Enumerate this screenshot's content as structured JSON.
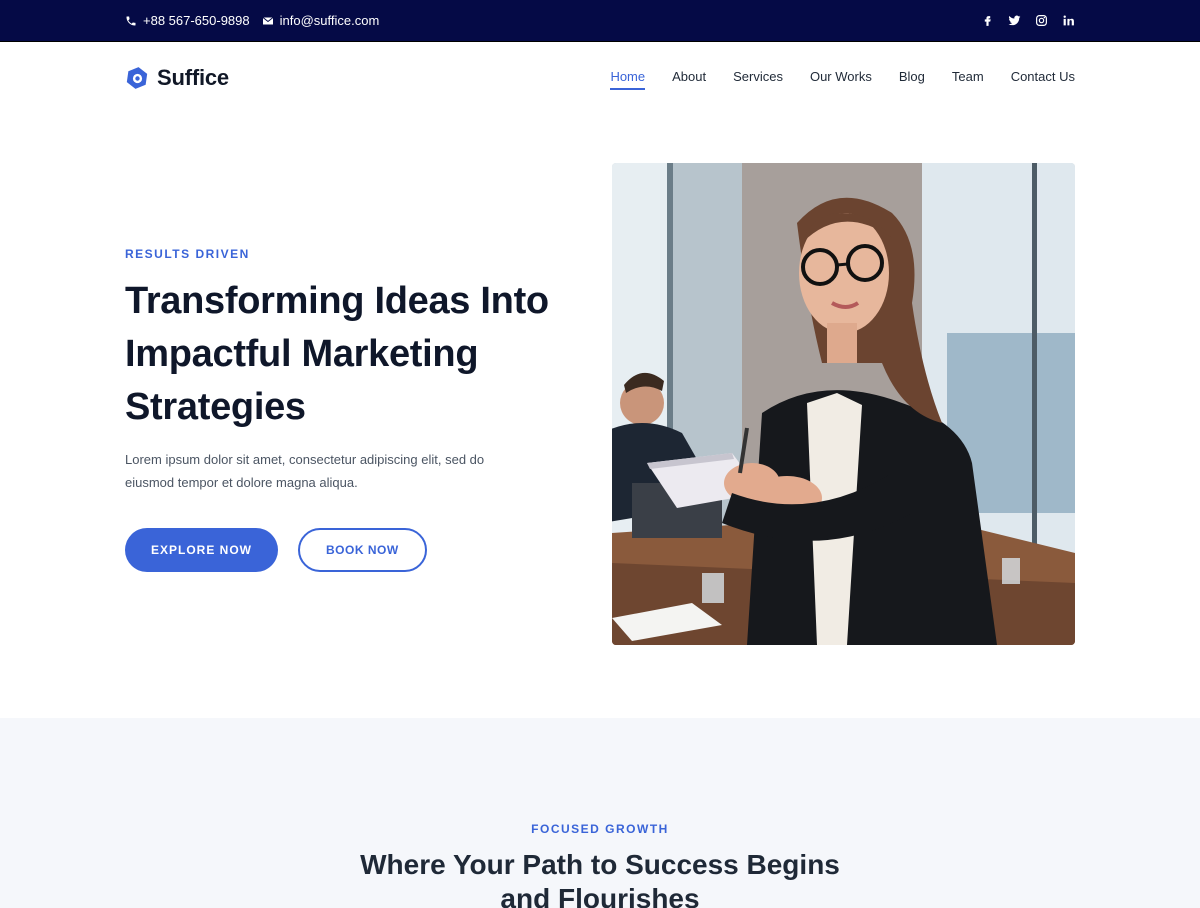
{
  "topbar": {
    "phone": "+88 567-650-9898",
    "email": "info@suffice.com",
    "socials": [
      "facebook",
      "twitter",
      "instagram",
      "linkedin"
    ]
  },
  "header": {
    "logo_text": "Suffice",
    "nav": [
      {
        "label": "Home",
        "active": true
      },
      {
        "label": "About"
      },
      {
        "label": "Services"
      },
      {
        "label": "Our Works"
      },
      {
        "label": "Blog"
      },
      {
        "label": "Team"
      },
      {
        "label": "Contact Us"
      }
    ]
  },
  "hero": {
    "eyebrow": "RESULTS DRIVEN",
    "title": "Transforming Ideas Into Impactful Marketing Strategies",
    "description": "Lorem ipsum dolor sit amet, consectetur adipiscing elit, sed do eiusmod tempor et dolore magna aliqua.",
    "primary_button": "EXPLORE NOW",
    "secondary_button": "BOOK NOW"
  },
  "section2": {
    "eyebrow": "FOCUSED GROWTH",
    "title": "Where Your Path to Success Begins and Flourishes"
  },
  "colors": {
    "accent": "#3a64d8",
    "topbar_bg": "#050a46",
    "section_bg": "#f5f7fb"
  },
  "icons": {
    "phone": "phone-icon",
    "email": "envelope-icon",
    "logo": "suffice-logo-icon"
  }
}
